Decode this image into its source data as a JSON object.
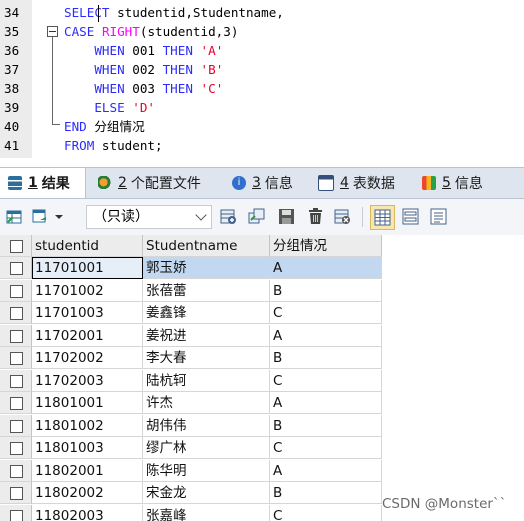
{
  "editor": {
    "lines": [
      {
        "num": "34",
        "parts": [
          {
            "t": "SELECT",
            "c": "kw"
          },
          {
            "t": " studentid,Studentname,",
            "c": "plain"
          }
        ]
      },
      {
        "num": "35",
        "parts": [
          {
            "t": "CASE",
            "c": "kw"
          },
          {
            "t": " ",
            "c": "plain"
          },
          {
            "t": "RIGHT",
            "c": "fn"
          },
          {
            "t": "(studentid,3)",
            "c": "plain"
          }
        ]
      },
      {
        "num": "36",
        "parts": [
          {
            "t": "    WHEN",
            "c": "kw"
          },
          {
            "t": " 001 ",
            "c": "plain"
          },
          {
            "t": "THEN",
            "c": "kw"
          },
          {
            "t": " ",
            "c": "plain"
          },
          {
            "t": "'A'",
            "c": "str"
          }
        ]
      },
      {
        "num": "37",
        "parts": [
          {
            "t": "    WHEN",
            "c": "kw"
          },
          {
            "t": " 002 ",
            "c": "plain"
          },
          {
            "t": "THEN",
            "c": "kw"
          },
          {
            "t": " ",
            "c": "plain"
          },
          {
            "t": "'B'",
            "c": "str"
          }
        ]
      },
      {
        "num": "38",
        "parts": [
          {
            "t": "    WHEN",
            "c": "kw"
          },
          {
            "t": " 003 ",
            "c": "plain"
          },
          {
            "t": "THEN",
            "c": "kw"
          },
          {
            "t": " ",
            "c": "plain"
          },
          {
            "t": "'C'",
            "c": "str"
          }
        ]
      },
      {
        "num": "39",
        "parts": [
          {
            "t": "    ELSE",
            "c": "kw"
          },
          {
            "t": " ",
            "c": "plain"
          },
          {
            "t": "'D'",
            "c": "str"
          }
        ]
      },
      {
        "num": "40",
        "parts": [
          {
            "t": "END",
            "c": "kw"
          },
          {
            "t": " 分组情况",
            "c": "plain"
          }
        ]
      },
      {
        "num": "41",
        "parts": [
          {
            "t": "FROM",
            "c": "kw"
          },
          {
            "t": " student;",
            "c": "plain"
          }
        ]
      }
    ]
  },
  "tabs": [
    {
      "num": "1",
      "label": "结果"
    },
    {
      "num": "2",
      "label": "个配置文件"
    },
    {
      "num": "3",
      "label": "信息"
    },
    {
      "num": "4",
      "label": "表数据"
    },
    {
      "num": "5",
      "label": "信息"
    }
  ],
  "toolbar": {
    "readonly_label": "（只读）"
  },
  "grid": {
    "columns": [
      "studentid",
      "Studentname",
      "分组情况"
    ],
    "rows": [
      [
        "11701001",
        "郭玉娇",
        "A"
      ],
      [
        "11701002",
        "张蓓蕾",
        "B"
      ],
      [
        "11701003",
        "姜鑫锋",
        "C"
      ],
      [
        "11702001",
        "姜祝进",
        "A"
      ],
      [
        "11702002",
        "李大春",
        "B"
      ],
      [
        "11702003",
        "陆杭轲",
        "C"
      ],
      [
        "11801001",
        "许杰",
        "A"
      ],
      [
        "11801002",
        "胡伟伟",
        "B"
      ],
      [
        "11801003",
        "缪广林",
        "C"
      ],
      [
        "11802001",
        "陈华明",
        "A"
      ],
      [
        "11802002",
        "宋金龙",
        "B"
      ],
      [
        "11802003",
        "张嘉峰",
        "C"
      ]
    ]
  },
  "watermark": "CSDN @Monster``",
  "colors": {
    "keyword": "#2c2cff",
    "function": "#ff00ff",
    "string": "#e8002a",
    "selected_row": "#c1d8f0"
  }
}
